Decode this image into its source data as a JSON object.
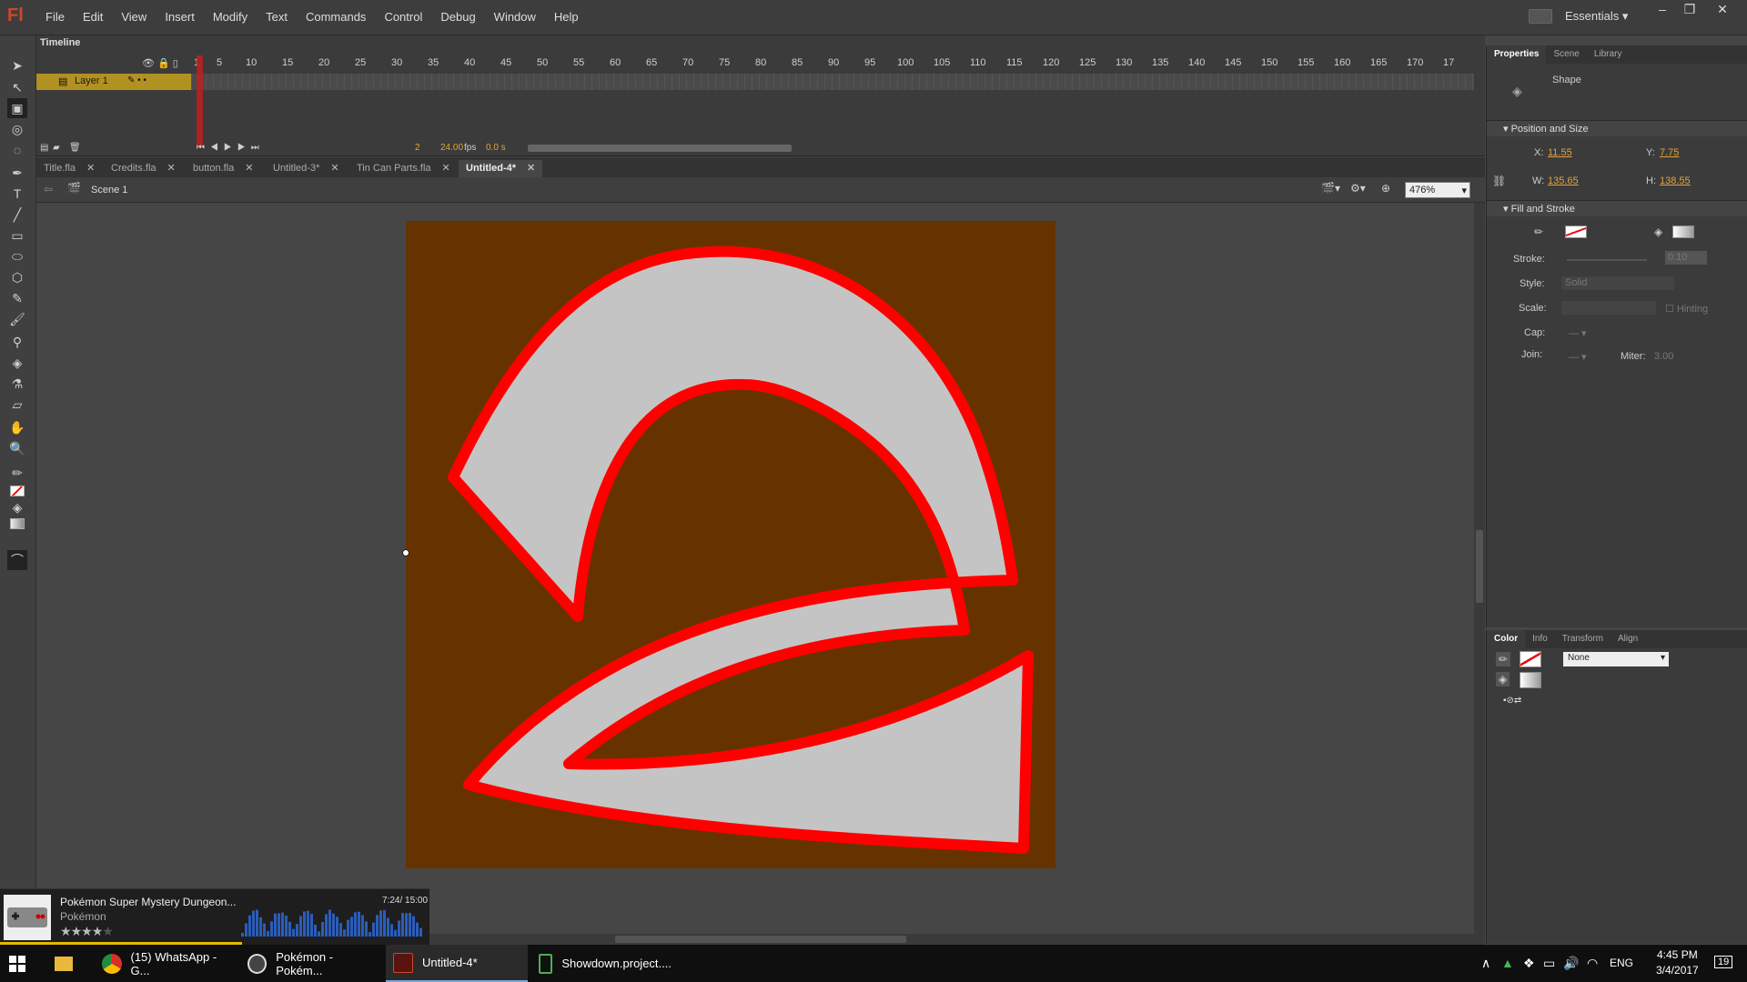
{
  "app": {
    "logo": "Fl"
  },
  "menu": [
    "File",
    "Edit",
    "View",
    "Insert",
    "Modify",
    "Text",
    "Commands",
    "Control",
    "Debug",
    "Window",
    "Help"
  ],
  "workspace": "Essentials",
  "timeline": {
    "tab": "Timeline",
    "ruler": [
      "1",
      "5",
      "10",
      "15",
      "20",
      "25",
      "30",
      "35",
      "40",
      "45",
      "50",
      "55",
      "60",
      "65",
      "70",
      "75",
      "80",
      "85",
      "90",
      "95",
      "100",
      "105",
      "110",
      "115",
      "120",
      "125",
      "130",
      "135",
      "140",
      "145",
      "150",
      "155",
      "160",
      "165",
      "170",
      "17"
    ],
    "layer": "Layer 1",
    "frame": "2",
    "fps": "24.00",
    "fps_unit": "fps",
    "time": "0.0 s"
  },
  "doc_tabs": [
    {
      "label": "Title.fla",
      "active": false
    },
    {
      "label": "Credits.fla",
      "active": false
    },
    {
      "label": "button.fla",
      "active": false
    },
    {
      "label": "Untitled-3*",
      "active": false
    },
    {
      "label": "Tin Can Parts.fla",
      "active": false
    },
    {
      "label": "Untitled-4*",
      "active": true
    }
  ],
  "scene": "Scene 1",
  "zoom": "476%",
  "stage_colors": {
    "background": "#663300",
    "fill": "#c4c4c4",
    "stroke": "#ff0000"
  },
  "properties": {
    "tabs": [
      "Properties",
      "Scene",
      "Library"
    ],
    "type": "Shape",
    "section_pos": "Position and Size",
    "x_label": "X:",
    "x": "11.55",
    "y_label": "Y:",
    "y": "7.75",
    "w_label": "W:",
    "w": "135.65",
    "h_label": "H:",
    "h": "138.55",
    "section_fill": "Fill and Stroke",
    "stroke_label": "Stroke:",
    "stroke_value": "0.10",
    "style_label": "Style:",
    "style_value": "Solid",
    "scale_label": "Scale:",
    "hinting": "Hinting",
    "cap_label": "Cap:",
    "join_label": "Join:",
    "miter_label": "Miter:",
    "miter": "3.00"
  },
  "color_panel": {
    "tabs": [
      "Color",
      "Info",
      "Transform",
      "Align"
    ],
    "type": "None"
  },
  "media": {
    "title": "Pokémon Super Mystery Dungeon...",
    "artist": "Pokémon",
    "time": "7:24/ 15:00",
    "stars": "★★★★★",
    "rating": 4
  },
  "taskbar": {
    "items": [
      "(15) WhatsApp - G...",
      "Pokémon - Pokém...",
      "Untitled-4*",
      "Showdown.project...."
    ],
    "lang": "ENG",
    "time": "4:45 PM",
    "date": "3/4/2017",
    "notif": "19"
  }
}
